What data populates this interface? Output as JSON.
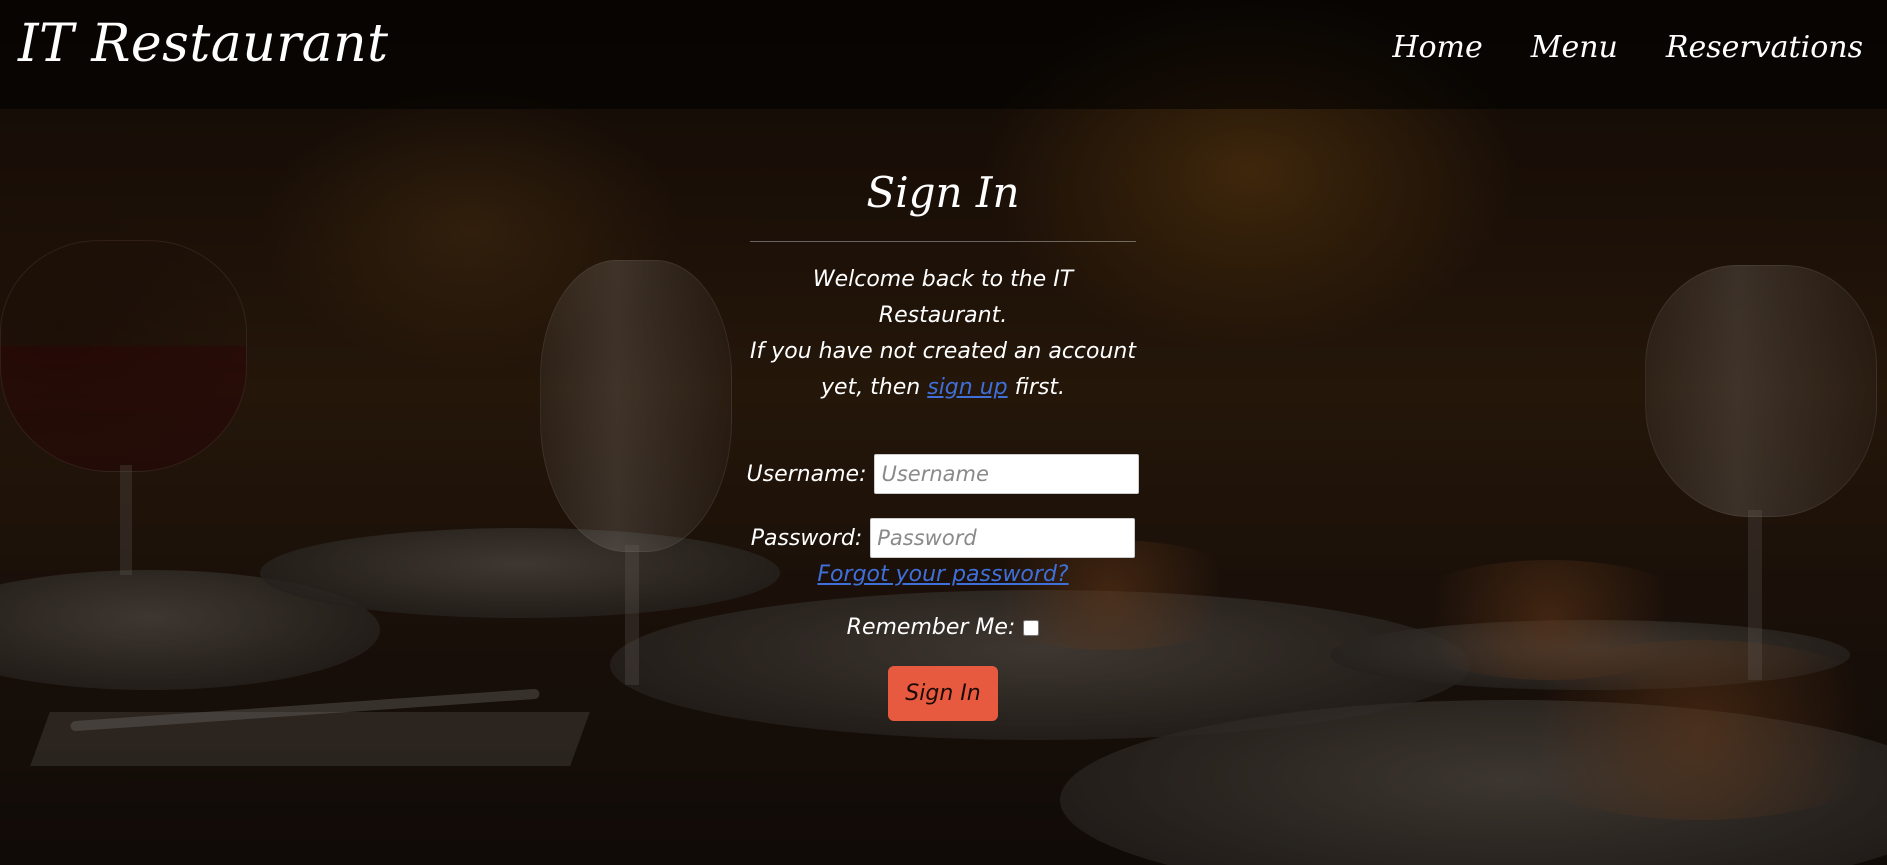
{
  "header": {
    "brand": "IT Restaurant",
    "nav": [
      {
        "label": "Home"
      },
      {
        "label": "Menu"
      },
      {
        "label": "Reservations"
      }
    ]
  },
  "signin": {
    "title": "Sign In",
    "welcome_line1": "Welcome back to the IT Restaurant.",
    "welcome_line2": "If you have not created an account",
    "welcome_line3_prefix": "yet, then",
    "signup_link": "sign up",
    "welcome_line3_suffix": "first.",
    "username_label": "Username:",
    "username_placeholder": "Username",
    "username_value": "",
    "password_label": "Password:",
    "password_placeholder": "Password",
    "password_value": "",
    "forgot_link": "Forgot your password?",
    "remember_label": "Remember Me:",
    "remember_checked": false,
    "submit_label": "Sign In"
  },
  "colors": {
    "accent_button": "#e85a3f",
    "link": "#3f6fd8",
    "navbar_bg": "rgba(0,0,0,0.55)",
    "text": "#ffffff"
  }
}
